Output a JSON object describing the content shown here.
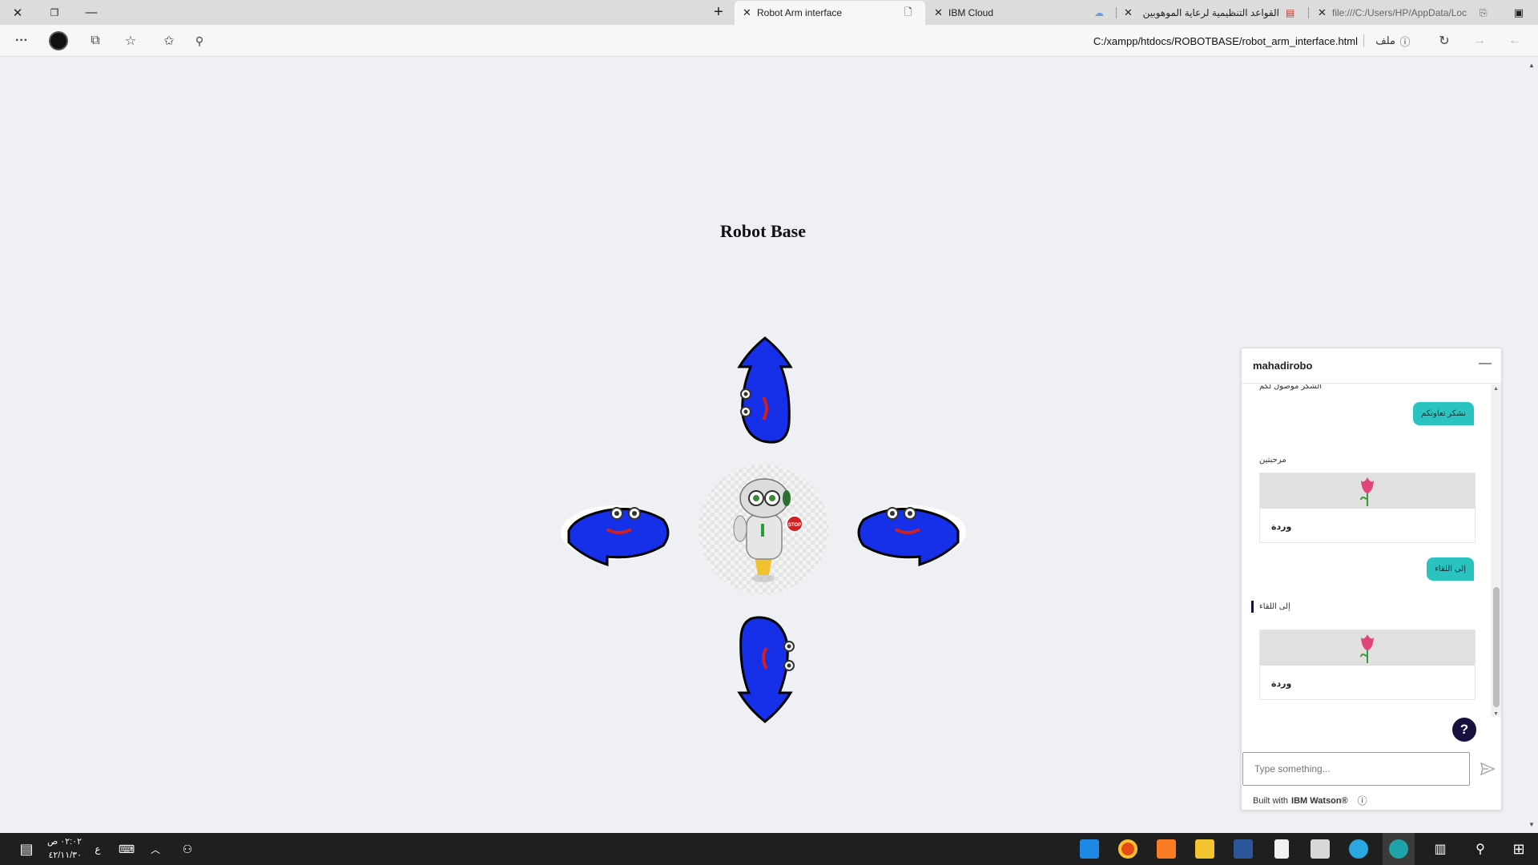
{
  "browser": {
    "tabs": [
      {
        "title": "Robot Arm interface",
        "active": true
      },
      {
        "title": "IBM Cloud",
        "active": false
      },
      {
        "title": "القواعد التنظيمية لرعاية الموهوبين",
        "active": false
      },
      {
        "title": "file:///C:/Users/HP/AppData/Loc",
        "active": false
      }
    ],
    "address": "C:/xampp/htdocs/ROBOTBASE/robot_arm_interface.html",
    "address_prefix": "ملف"
  },
  "page": {
    "title": "Robot Base",
    "arrow_color": "#1530e8"
  },
  "chat": {
    "name": "mahadirobo",
    "messages": [
      {
        "from": "bot",
        "text": "الشكر موصول لكم"
      },
      {
        "from": "user",
        "text": "نشكر تعاونكم"
      },
      {
        "from": "bot",
        "text": "مرحبتين"
      },
      {
        "from": "bot-card",
        "label": "وردة"
      },
      {
        "from": "user",
        "text": "إلى اللقاء"
      },
      {
        "from": "bot",
        "text": "إلى اللقاء"
      },
      {
        "from": "bot-card",
        "label": "وردة"
      }
    ],
    "input_placeholder": "Type something...",
    "footer_prefix": "Built with",
    "footer_brand": "IBM Watson®",
    "accent": "#2bc3c0"
  },
  "taskbar": {
    "clock_time": "٠٢:٠٢ ص",
    "clock_date": "٤٢/١١/٣٠",
    "lang": "ع"
  }
}
